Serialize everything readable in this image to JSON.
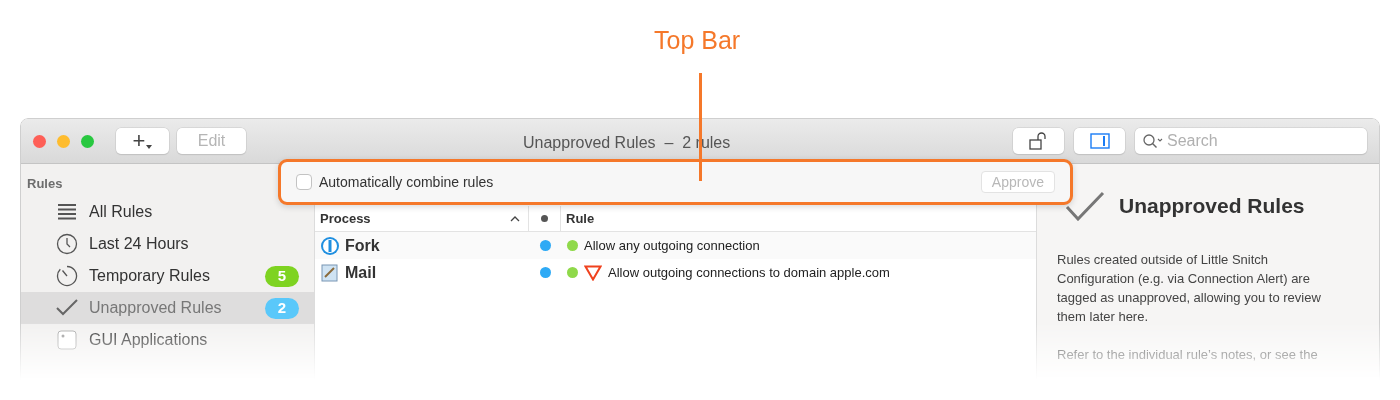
{
  "callout": {
    "label": "Top Bar"
  },
  "window": {
    "title": "Unapproved Rules  –  2 rules"
  },
  "toolbar": {
    "add_button": {
      "label": "+"
    },
    "edit_button": {
      "label": "Edit",
      "disabled": true
    },
    "inspector_toggle": {
      "selected": true
    },
    "search": {
      "placeholder": "Search"
    }
  },
  "sidebar": {
    "heading": "Rules",
    "items": [
      {
        "kind": "list",
        "label": "All Rules",
        "selected": false
      },
      {
        "kind": "clock",
        "label": "Last 24 Hours",
        "selected": false
      },
      {
        "kind": "timer",
        "label": "Temporary Rules",
        "badge": "5",
        "color": "#7ed321",
        "selected": false
      },
      {
        "kind": "check",
        "label": "Unapproved Rules",
        "badge": "2",
        "color": "#5ac8fa",
        "selected": true
      },
      {
        "kind": "app",
        "label": "GUI Applications",
        "selected": false
      }
    ]
  },
  "top_bar": {
    "checkbox": {
      "label": "Automatically combine rules",
      "checked": false
    },
    "approve_button": {
      "label": "Approve",
      "disabled": true
    }
  },
  "table": {
    "columns": [
      "Process",
      "Rule"
    ],
    "rows": [
      {
        "kind": "fork",
        "process": "Fork",
        "warning": false,
        "rule": "Allow any outgoing connection"
      },
      {
        "kind": "mail",
        "process": "Mail",
        "warning": true,
        "rule": "Allow outgoing connections to domain apple.com"
      }
    ]
  },
  "inspector": {
    "title": "Unapproved Rules",
    "paragraphs": [
      "Rules created outside of Little Snitch Configuration (e.g. via Connection Alert) are tagged as unapproved, allowing you to review them later here.",
      "Refer to the individual rule’s notes, or see the"
    ]
  }
}
